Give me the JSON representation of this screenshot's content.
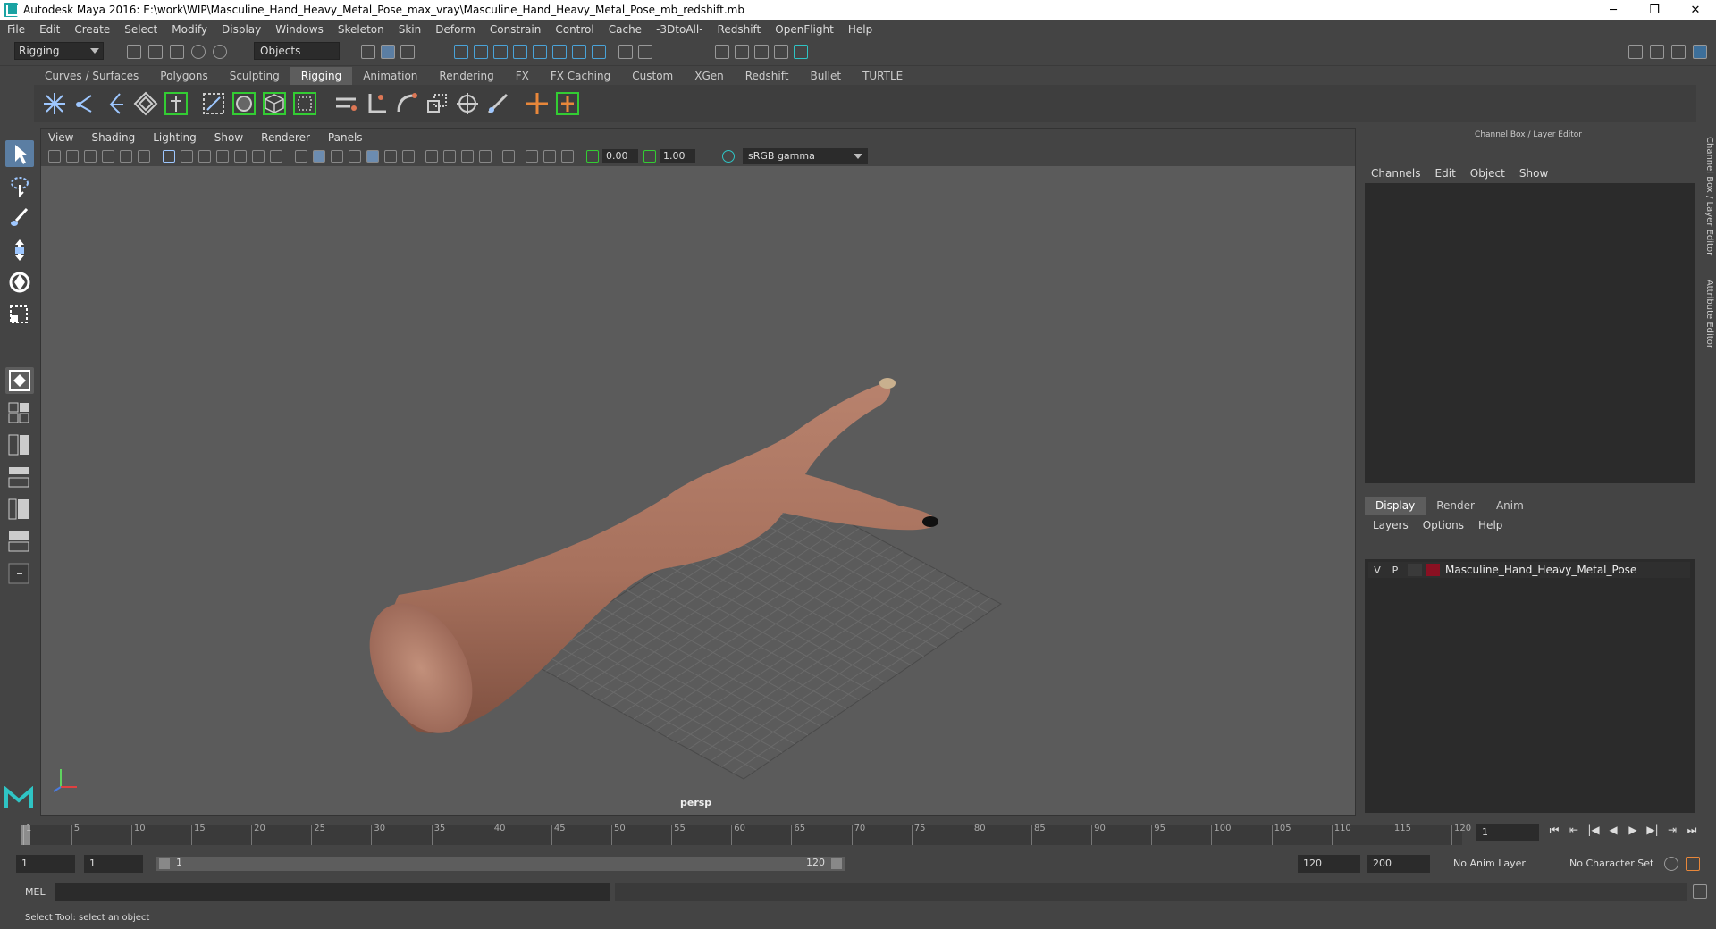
{
  "window": {
    "title": "Autodesk Maya 2016: E:\\work\\WIP\\Masculine_Hand_Heavy_Metal_Pose_max_vray\\Masculine_Hand_Heavy_Metal_Pose_mb_redshift.mb",
    "min": "─",
    "restore": "❐",
    "close": "✕"
  },
  "menubar": [
    "File",
    "Edit",
    "Create",
    "Select",
    "Modify",
    "Display",
    "Windows",
    "Skeleton",
    "Skin",
    "Deform",
    "Constrain",
    "Control",
    "Cache",
    "-3DtoAll-",
    "Redshift",
    "OpenFlight",
    "Help"
  ],
  "status": {
    "mode": "Rigging",
    "objects_field": "Objects"
  },
  "shelf_tabs": [
    "Curves / Surfaces",
    "Polygons",
    "Sculpting",
    "Rigging",
    "Animation",
    "Rendering",
    "FX",
    "FX Caching",
    "Custom",
    "XGen",
    "Redshift",
    "Bullet",
    "TURTLE"
  ],
  "shelf_active": "Rigging",
  "viewport": {
    "menu": [
      "View",
      "Shading",
      "Lighting",
      "Show",
      "Renderer",
      "Panels"
    ],
    "exposure": "0.00",
    "gamma": "1.00",
    "colorspace": "sRGB gamma",
    "camera": "persp"
  },
  "channel_box": {
    "title": "Channel Box / Layer Editor",
    "menu": [
      "Channels",
      "Edit",
      "Object",
      "Show"
    ]
  },
  "layer_editor": {
    "tabs": [
      "Display",
      "Render",
      "Anim"
    ],
    "active_tab": "Display",
    "menu": [
      "Layers",
      "Options",
      "Help"
    ],
    "layers": [
      {
        "v": "V",
        "p": "P",
        "name": "Masculine_Hand_Heavy_Metal_Pose",
        "color": "#8a1022"
      }
    ]
  },
  "side_tabs": [
    "Channel Box / Layer Editor",
    "Attribute Editor"
  ],
  "timeline": {
    "ticks": [
      "1",
      "5",
      "10",
      "15",
      "20",
      "25",
      "30",
      "35",
      "40",
      "45",
      "50",
      "55",
      "60",
      "65",
      "70",
      "75",
      "80",
      "85",
      "90",
      "95",
      "100",
      "105",
      "110",
      "115",
      "120"
    ],
    "current_frame": "1"
  },
  "range": {
    "start": "1",
    "start2": "1",
    "slider_start": "1",
    "slider_end": "120",
    "end": "120",
    "end2": "200",
    "anim_layer": "No Anim Layer",
    "char_set": "No Character Set"
  },
  "command": {
    "label": "MEL"
  },
  "help_line": "Select Tool: select an object",
  "playback": [
    "⏮",
    "⇤",
    "|◀",
    "◀",
    "▶",
    "▶|",
    "⇥",
    "⏭"
  ]
}
